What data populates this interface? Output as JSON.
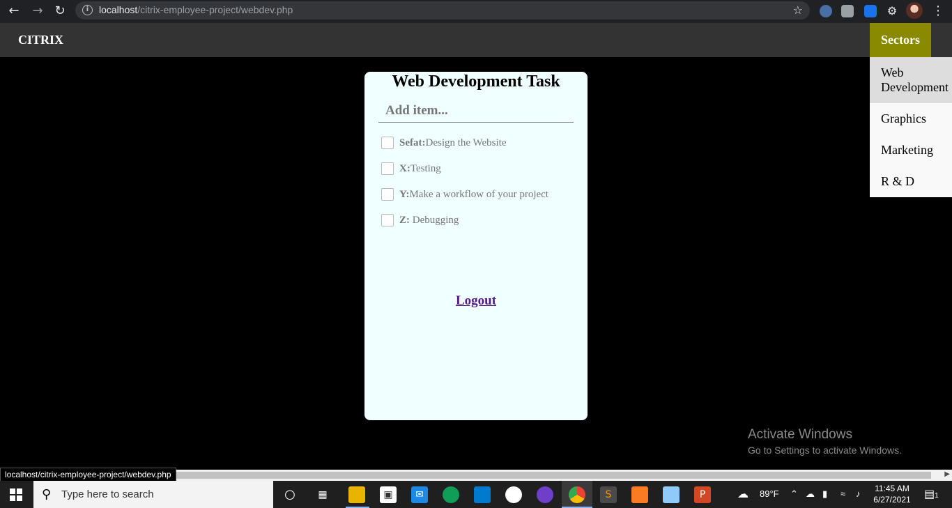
{
  "browser": {
    "url_host": "localhost",
    "url_path": "/citrix-employee-project/webdev.php"
  },
  "header": {
    "brand": "CITRIX",
    "sectors_label": "Sectors"
  },
  "sectors_menu": {
    "items": [
      {
        "label": "Web Development",
        "active": true
      },
      {
        "label": "Graphics",
        "active": false
      },
      {
        "label": "Marketing",
        "active": false
      },
      {
        "label": "R & D",
        "active": false
      }
    ]
  },
  "card": {
    "title": "Web Development Task",
    "add_placeholder": "Add item...",
    "tasks": [
      {
        "name": "Sefat:",
        "text": "Design the Website"
      },
      {
        "name": "X:",
        "text": "Testing"
      },
      {
        "name": "Y:",
        "text": "Make a workflow of your project"
      },
      {
        "name": "Z:",
        "text": " Debugging"
      }
    ],
    "logout_label": "Logout"
  },
  "watermark": {
    "line1": "Activate Windows",
    "line2": "Go to Settings to activate Windows."
  },
  "status_bar": {
    "text": "localhost/citrix-employee-project/webdev.php"
  },
  "taskbar": {
    "search_placeholder": "Type here to search",
    "weather": "89°F",
    "time": "11:45 AM",
    "date": "6/27/2021",
    "notifications": "1"
  }
}
